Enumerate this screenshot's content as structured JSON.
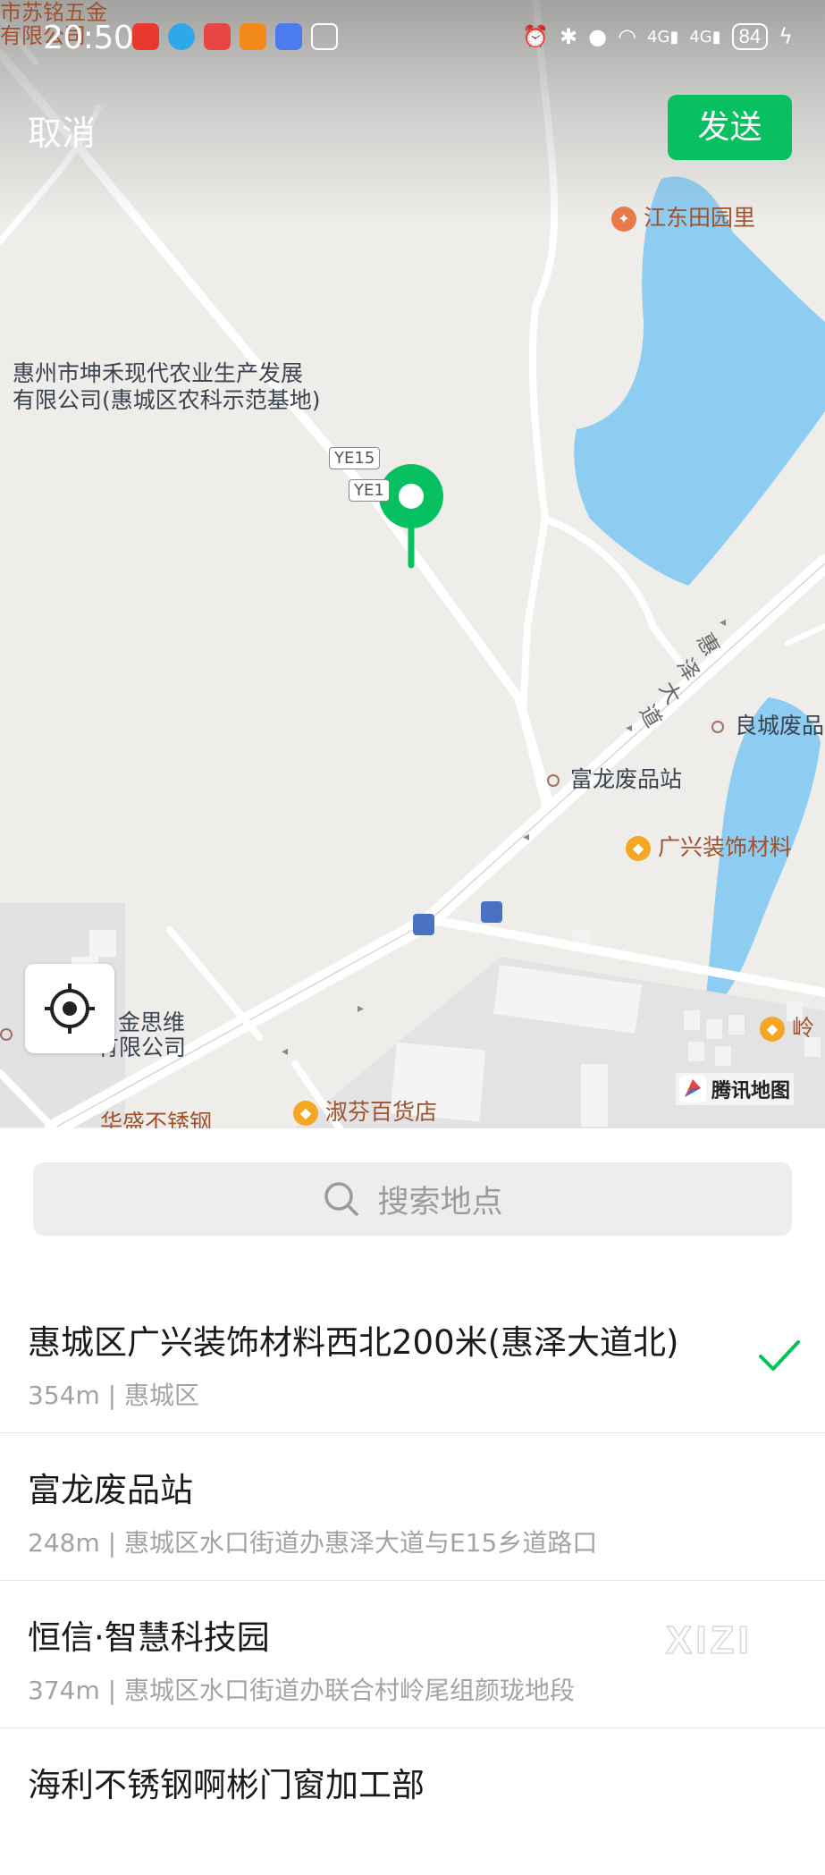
{
  "status_bar": {
    "time": "20:50",
    "battery": "84"
  },
  "header": {
    "cancel_label": "取消",
    "send_label": "发送",
    "accent_color": "#07c160"
  },
  "map": {
    "pois": {
      "top_left_1": "市苏铭五金",
      "top_left_2": "有限公司",
      "jiangdong": "江东田园里",
      "kunhe_1": "惠州市坤禾现代农业生产发展",
      "kunhe_2": "有限公司(惠城区农科示范基地)",
      "fulong": "富龙废品站",
      "liangcheng": "良城废品",
      "guangxing": "广兴装饰材料",
      "siwei_1": "金思维",
      "siwei_2": "有限公司",
      "shufen": "淑芬百货店",
      "huasheng": "华盛不锈钢",
      "ling": "岭"
    },
    "road_labels": {
      "ye15_a": "YE15",
      "ye15_b": "YE1",
      "huize_1": "惠",
      "huize_2": "泽",
      "huize_3": "大",
      "huize_4": "道"
    },
    "provider": "腾讯地图"
  },
  "search": {
    "placeholder": "搜索地点"
  },
  "results": [
    {
      "title": "惠城区广兴装饰材料西北200米(惠泽大道北)",
      "distance": "354m",
      "address": "惠城区",
      "selected": true
    },
    {
      "title": "富龙废品站",
      "distance": "248m",
      "address": "惠城区水口街道办惠泽大道与E15乡道路口",
      "selected": false
    },
    {
      "title": "恒信·智慧科技园",
      "distance": "374m",
      "address": "惠城区水口街道办联合村岭尾组颜珑地段",
      "selected": false
    },
    {
      "title": "海利不锈钢啊彬门窗加工部",
      "distance": "",
      "address": "",
      "selected": false
    }
  ],
  "watermark": "XIZI"
}
